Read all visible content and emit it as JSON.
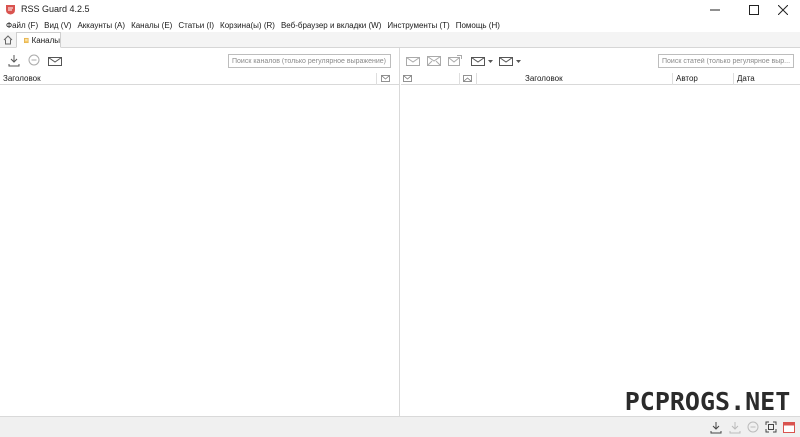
{
  "window": {
    "title": "RSS Guard 4.2.5",
    "controls": [
      "minimize",
      "maximize",
      "close"
    ]
  },
  "menubar": {
    "items": [
      {
        "label": "Файл (F)"
      },
      {
        "label": "Вид (V)"
      },
      {
        "label": "Аккаунты (A)"
      },
      {
        "label": "Каналы (E)"
      },
      {
        "label": "Статьи (I)"
      },
      {
        "label": "Корзина(ы) (R)"
      },
      {
        "label": "Веб-браузер и вкладки (W)"
      },
      {
        "label": "Инструменты (T)"
      },
      {
        "label": "Помощь (H)"
      }
    ]
  },
  "tabs": {
    "home_icon": "home-icon",
    "feeds_tab": {
      "label": "Каналы",
      "icon": "feed-folder-icon"
    }
  },
  "feeds_pane": {
    "toolbar_icons": [
      "download-icon",
      "stop-icon",
      "mark-read-icon"
    ],
    "search_placeholder": "Поиск каналов (только регулярное выражение)",
    "columns": [
      {
        "label": "Заголовок"
      },
      {
        "icon": "unread-envelope-icon"
      }
    ]
  },
  "articles_pane": {
    "toolbar_icons": [
      "mark-read-icon",
      "mark-unread-icon",
      "open-icon",
      "mark-dropdown-icon",
      "filter-dropdown-icon"
    ],
    "search_placeholder": "Поиск статей (только регулярное выр...",
    "columns": [
      {
        "icon": "envelope-icon"
      },
      {
        "icon": "envelope-open-icon"
      },
      {
        "label": "Заголовок"
      },
      {
        "label": "Автор"
      },
      {
        "label": "Дата"
      }
    ]
  },
  "statusbar": {
    "icons": [
      "download-icon",
      "download-disabled-icon",
      "stop-disabled-icon",
      "fullscreen-icon",
      "calendar-icon"
    ]
  },
  "watermark": {
    "text": "PCPROGS.NET"
  },
  "colors": {
    "accent": "#d9534f",
    "border": "#d9d9d9",
    "statusbar_bg": "#f0f0f0"
  }
}
